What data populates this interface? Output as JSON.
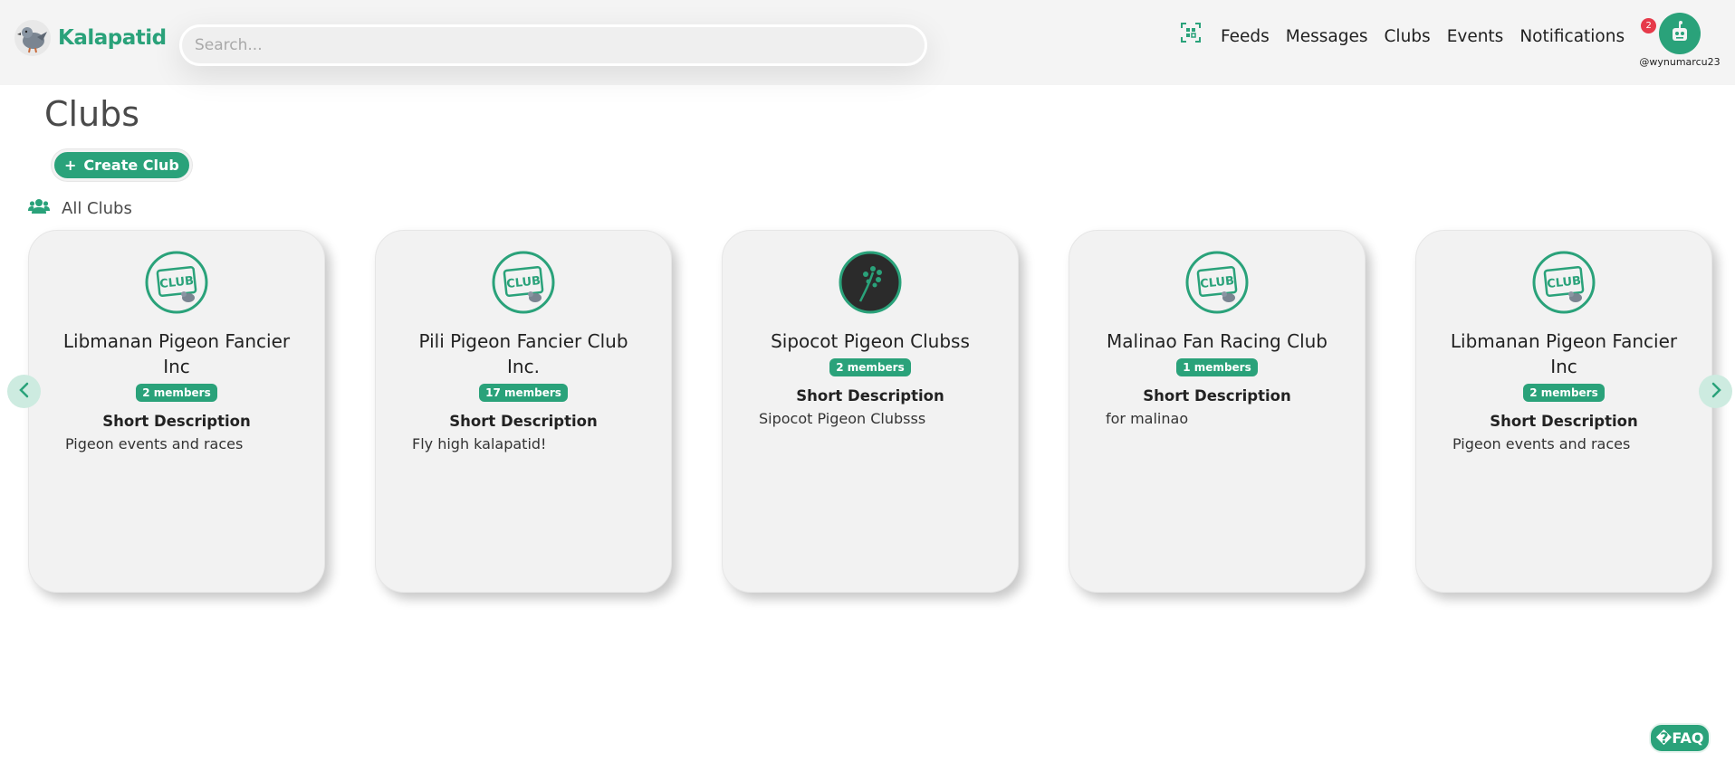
{
  "header": {
    "app_name": "Kalapatid",
    "search_placeholder": "Search...",
    "nav": [
      "Feeds",
      "Messages",
      "Clubs",
      "Events",
      "Notifications"
    ],
    "notification_count": "2",
    "username": "@wynumarcu23",
    "icons": {
      "logo": "pigeon-logo-icon",
      "qr": "qr-scan-icon",
      "avatar": "robot-avatar-icon"
    }
  },
  "page": {
    "title": "Clubs",
    "create_button": "Create Club",
    "create_icon": "+",
    "section_label": "All Clubs",
    "section_icon": "users-icon"
  },
  "clubs": [
    {
      "name": "Libmanan Pigeon Fancier Inc",
      "members": "2 members",
      "short_title": "Short Description",
      "description": "Pigeon events and races",
      "logo": "club-badge-icon"
    },
    {
      "name": "Pili Pigeon Fancier Club Inc.",
      "members": "17 members",
      "short_title": "Short Description",
      "description": "Fly high kalapatid!",
      "logo": "club-badge-icon"
    },
    {
      "name": "Sipocot Pigeon Clubss",
      "members": "2 members",
      "short_title": "Short Description",
      "description": "Sipocot Pigeon Clubsss",
      "logo": "leaf-logo-icon"
    },
    {
      "name": "Malinao Fan Racing Club",
      "members": "1 members",
      "short_title": "Short Description",
      "description": "for malinao",
      "logo": "club-badge-icon"
    },
    {
      "name": "Libmanan Pigeon Fancier Inc",
      "members": "2 members",
      "short_title": "Short Description",
      "description": "Pigeon events and races",
      "logo": "club-badge-icon"
    }
  ],
  "faq_label": "�FAQ",
  "colors": {
    "accent": "#2aa27a",
    "badge": "#e63a4a",
    "card": "#f2f2f2"
  }
}
